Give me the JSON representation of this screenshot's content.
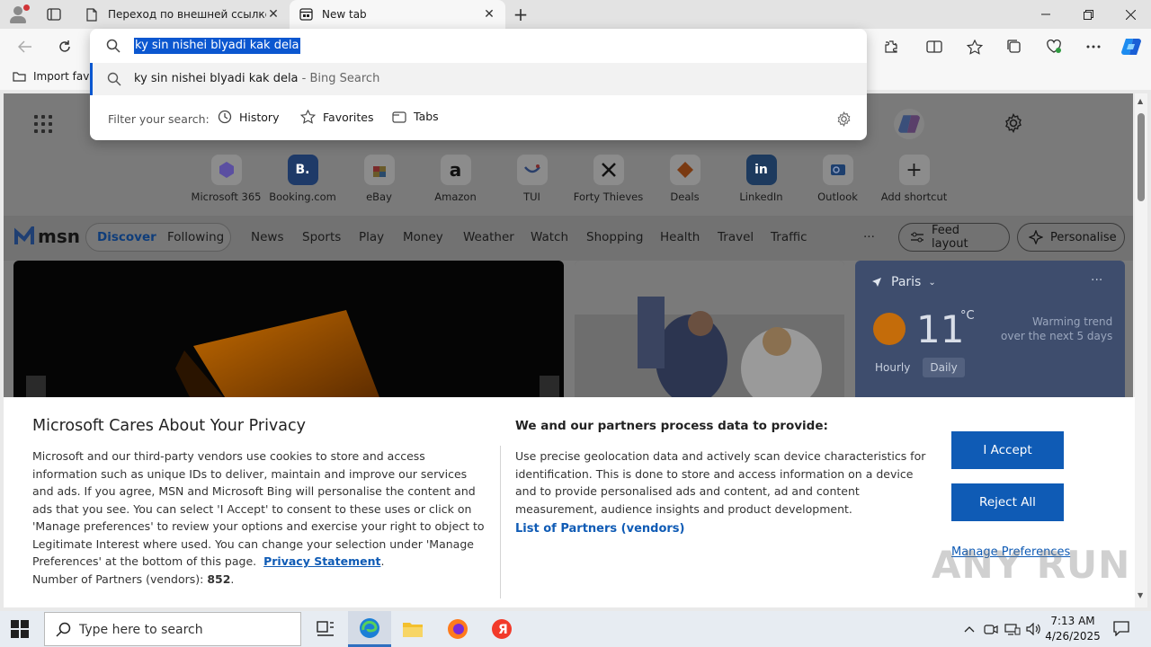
{
  "browser": {
    "tabs": [
      {
        "title": "Переход по внешней ссылке",
        "icon": "page-icon",
        "active": false
      },
      {
        "title": "New tab",
        "icon": "newtab-icon",
        "active": true
      }
    ],
    "favorites_bar": {
      "import_label": "Import favo"
    }
  },
  "omnibox": {
    "input_value": "ky sin nishei blyadi kak dela",
    "suggestion": {
      "query": "ky sin nishei blyadi kak dela",
      "suffix": " - Bing Search"
    },
    "filter_label": "Filter your search:",
    "filters": [
      "History",
      "Favorites",
      "Tabs"
    ]
  },
  "newtab": {
    "shortcuts": [
      {
        "label": "Microsoft 365",
        "glyph": ""
      },
      {
        "label": "Booking.com",
        "glyph": "B."
      },
      {
        "label": "eBay",
        "glyph": ""
      },
      {
        "label": "Amazon",
        "glyph": "a"
      },
      {
        "label": "TUI",
        "glyph": ""
      },
      {
        "label": "Forty Thieves",
        "glyph": ""
      },
      {
        "label": "Deals",
        "glyph": ""
      },
      {
        "label": "LinkedIn",
        "glyph": "in"
      },
      {
        "label": "Outlook",
        "glyph": ""
      },
      {
        "label": "Add shortcut",
        "glyph": "+"
      }
    ],
    "msn": {
      "logo": "msn",
      "nav": [
        "Discover",
        "Following",
        "News",
        "Sports",
        "Play",
        "Money",
        "Weather",
        "Watch",
        "Shopping",
        "Health",
        "Travel",
        "Traffic"
      ],
      "more": "···",
      "feed_layout": "Feed layout",
      "personalise": "Personalise"
    },
    "weather": {
      "city": "Paris",
      "temp": "11",
      "unit": "°C",
      "trend_line1": "Warming trend",
      "trend_line2": "over the next 5 days",
      "tabs": [
        "Hourly",
        "Daily"
      ],
      "selected_tab": "Daily"
    }
  },
  "privacy": {
    "title": "Microsoft Cares About Your Privacy",
    "body": "Microsoft and our third-party vendors use cookies to store and access information such as unique IDs to deliver, maintain and improve our services and ads. If you agree, MSN and Microsoft Bing will personalise the content and ads that you see. You can select 'I Accept' to consent to these uses or click on 'Manage preferences' to review your options and exercise your right to object to Legitimate Interest where used.  You can change your selection under 'Manage Preferences' at the bottom of this page.",
    "privacy_link": "Privacy Statement",
    "partners_label": "Number of Partners (vendors):",
    "partners_count": "852",
    "heading2": "We and our partners process data to provide:",
    "body2": "Use precise geolocation data and actively scan device characteristics for identification. This is done to store and access information on a device and to provide personalised ads and content, ad and content measurement, audience insights and product development.",
    "partners_link": "List of Partners (vendors)",
    "accept": "I Accept",
    "reject": "Reject All",
    "manage": "Manage Preferences"
  },
  "watermark": "ANY RUN",
  "taskbar": {
    "search_placeholder": "Type here to search",
    "time": "7:13 AM",
    "date": "4/26/2025"
  },
  "colors": {
    "accent": "#0f5bb5",
    "selection": "#0b57d0",
    "edge_blue": "#2f6fbf"
  }
}
